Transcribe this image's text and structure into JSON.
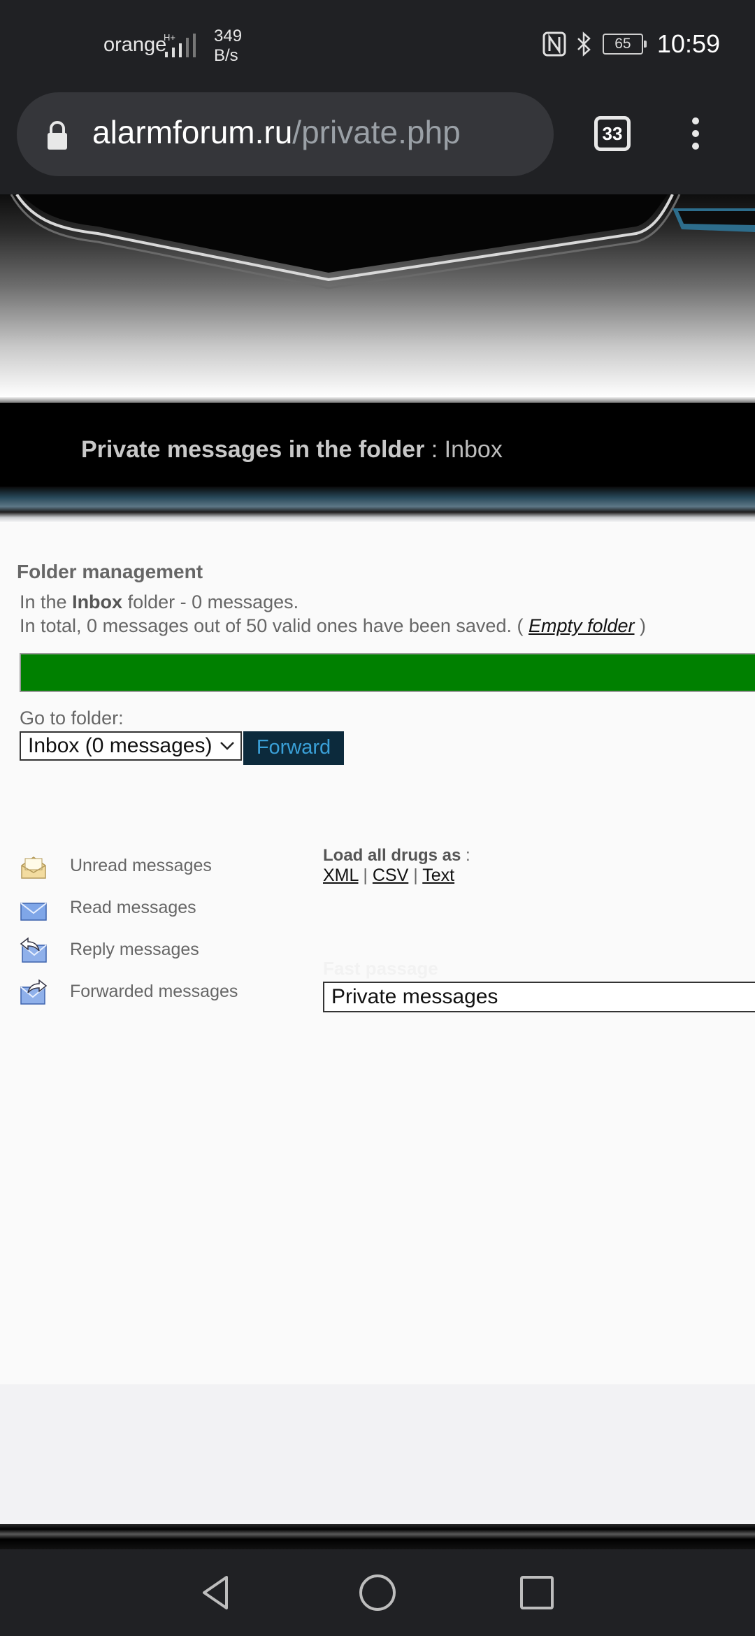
{
  "status_bar": {
    "carrier": "orange",
    "net_speed_value": "349",
    "net_speed_unit": "B/s",
    "battery": "65",
    "time": "10:59"
  },
  "browser": {
    "url_domain": "alarmforum.ru",
    "url_path": "/private.php",
    "tab_count": "33"
  },
  "header": {
    "title_prefix": "Private messages in the folder",
    "title_sep": " : ",
    "folder_name": "Inbox"
  },
  "folder_management": {
    "title": "Folder management",
    "line1_prefix": "In the ",
    "line1_folder": "Inbox",
    "line1_suffix": " folder - 0 messages.",
    "line2_text": "In total, 0 messages out of 50 valid ones have been saved. ( ",
    "empty_folder_link": "Empty folder",
    "line2_end": " )",
    "usage_fraction": 1.0,
    "progress_color": "#008000",
    "goto_label": "Go to folder:",
    "selected_folder": "Inbox (0 messages)",
    "forward_button": "Forward"
  },
  "legend": [
    {
      "label": "Unread messages",
      "icon": "unread-envelope-icon"
    },
    {
      "label": "Read messages",
      "icon": "read-envelope-icon"
    },
    {
      "label": "Reply messages",
      "icon": "reply-envelope-icon"
    },
    {
      "label": "Forwarded messages",
      "icon": "forward-envelope-icon"
    }
  ],
  "export": {
    "title": "Load all drugs as",
    "title_suffix": " :",
    "xml": "XML",
    "csv": "CSV",
    "text": "Text",
    "separator": " | "
  },
  "quick_nav": {
    "label": "Fast passage",
    "selected": "Private messages"
  }
}
